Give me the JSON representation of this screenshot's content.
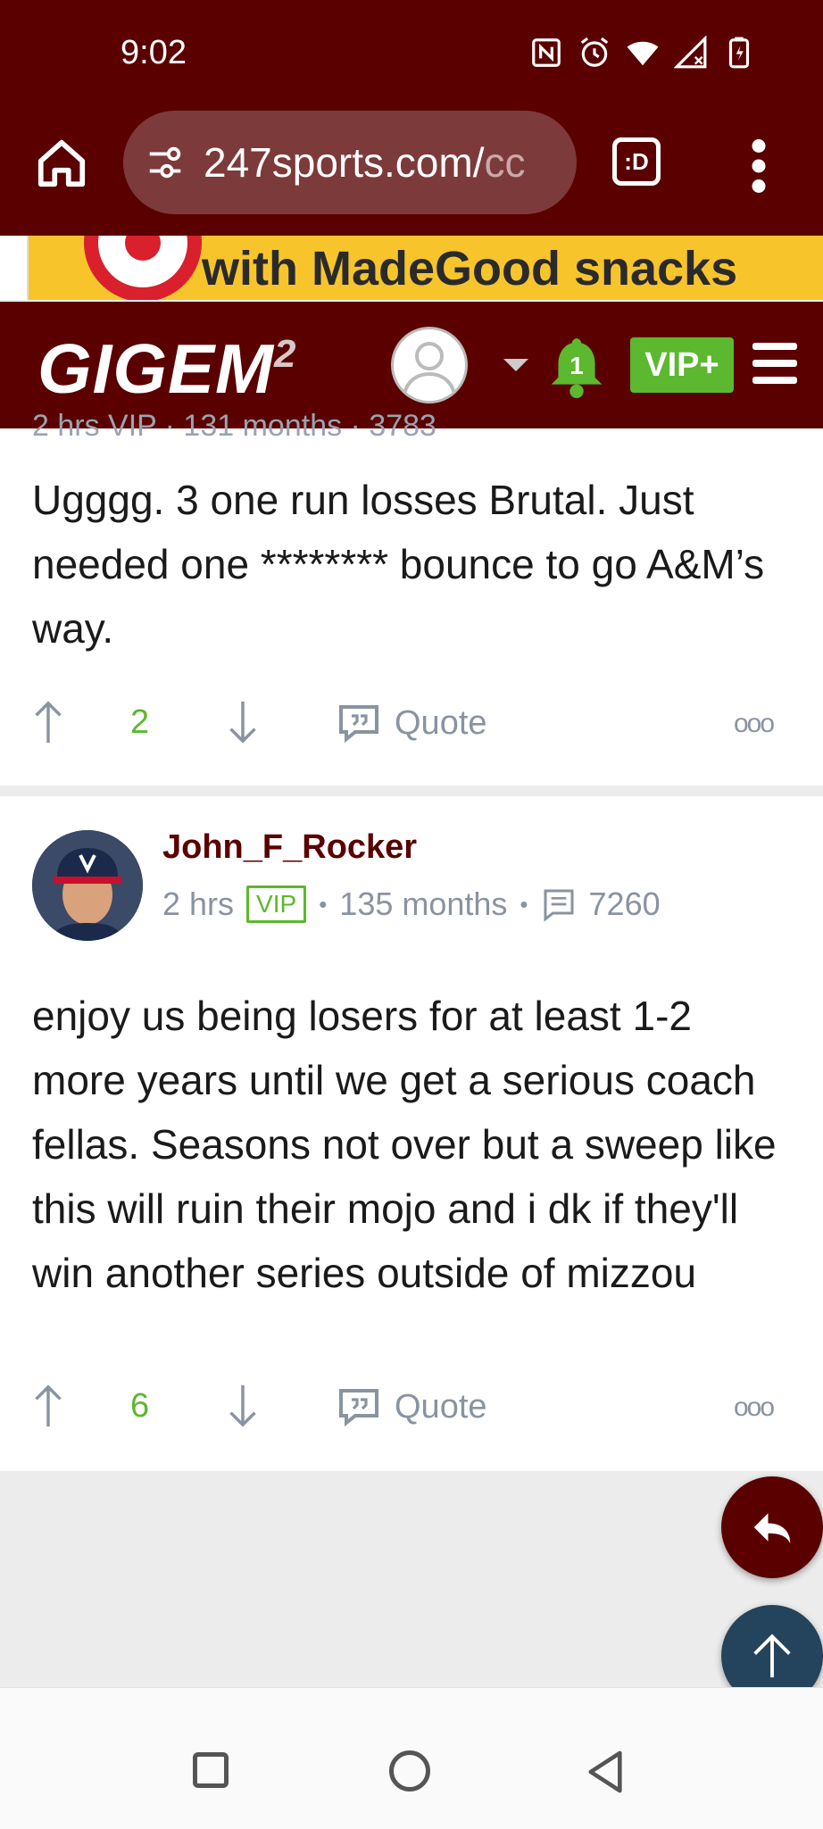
{
  "status_bar": {
    "time": "9:02"
  },
  "browser": {
    "url_main": "247sports.com/",
    "url_faded": "cc",
    "tab_label": ":D"
  },
  "ad": {
    "text": "with MadeGood snacks"
  },
  "site_header": {
    "logo": "GIGEM",
    "logo_suffix": "2",
    "notification_count": "1",
    "vip_label": "VIP+"
  },
  "posts": [
    {
      "meta_partial": "2 hrs   VIP   · 131 months ·   3783",
      "text": "Ugggg. 3 one run losses Brutal. Just needed one ******** bounce to go A&M’s way.",
      "votes": "2",
      "quote_label": "Quote",
      "more": "ooo"
    },
    {
      "username": "John_F_Rocker",
      "time": "2 hrs",
      "badge": "VIP",
      "tenure": "135 months",
      "post_count": "7260",
      "text": "enjoy us being losers for at least 1-2 more years until we get a serious coach fellas. Seasons not over but a sweep like this will ruin their mojo and i dk if they'll win another series outside of mizzou",
      "votes": "6",
      "quote_label": "Quote",
      "more": "ooo"
    }
  ],
  "colors": {
    "maroon": "#5a0000",
    "vip_green": "#5cb82e",
    "scroll_top": "#24435c"
  }
}
